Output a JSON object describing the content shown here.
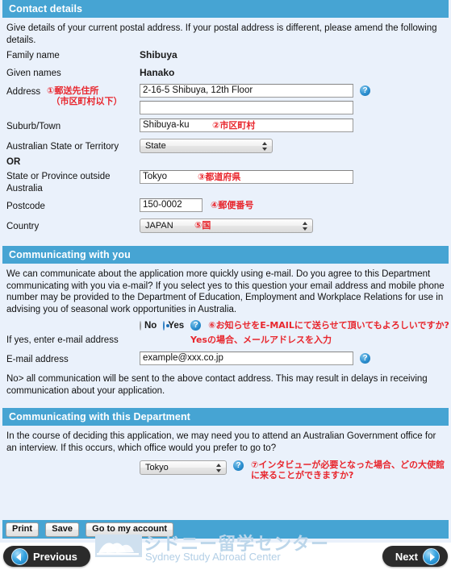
{
  "sections": {
    "contact": {
      "title": "Contact details",
      "intro": "Give details of your current postal address. If your postal address is different, please amend the following details.",
      "labels": {
        "family_name": "Family name",
        "given_names": "Given names",
        "address": "Address",
        "suburb": "Suburb/Town",
        "au_state": "Australian State or Territory",
        "or": "OR",
        "state_outside": "State or Province outside Australia",
        "postcode": "Postcode",
        "country": "Country"
      },
      "values": {
        "family_name": "Shibuya",
        "given_names": "Hanako",
        "address_line1": "2-16-5 Shibuya, 12th Floor",
        "address_line2": "",
        "suburb": "Shibuya-ku",
        "au_state": "State",
        "state_outside": "Tokyo",
        "postcode": "150-0002",
        "country": "JAPAN"
      },
      "annotations": {
        "address": "①郵送先住所\n　（市区町村以下）",
        "suburb": "②市区町村",
        "state_outside": "③都道府県",
        "postcode": "④郵便番号",
        "country": "⑤国"
      }
    },
    "communicating_you": {
      "title": "Communicating with you",
      "intro": "We can communicate about the application more quickly using e-mail. Do you agree to this Department communicating with you via e-mail? If you select yes to this question your email address and mobile phone number may be provided to the Department of Education, Employment and Workplace Relations for use in advising you of seasonal work opportunities in Australia.",
      "radio_no": "No",
      "radio_yes": "Yes",
      "selected": "Yes",
      "if_yes_label": "If yes, enter e-mail address",
      "email_label": "E-mail address",
      "email_value": "example@xxx.co.jp",
      "footnote": "No> all communication will be sent to the above contact address. This may result in delays in receiving communication about your application.",
      "annotations": {
        "radio": "⑥お知らせをE-MAILにて送らせて頂いてもよろしいですか?",
        "if_yes": "Yesの場合、メールアドレスを入力"
      }
    },
    "communicating_dept": {
      "title": "Communicating with this Department",
      "intro": "In the course of deciding this application, we may need you to attend an Australian Government office for an interview. If this occurs, which office would you prefer to go to?",
      "office_value": "Tokyo",
      "annotation": "⑦インタビューが必要となった場合、どの大使館\nに来ることができますか?"
    }
  },
  "toolbar": {
    "print": "Print",
    "save": "Save",
    "account": "Go to my account"
  },
  "nav": {
    "previous": "Previous",
    "next": "Next"
  },
  "watermark": {
    "jp": "シドニー留学センター",
    "en": "Sydney Study Abroad Center"
  },
  "icons": {
    "help": "?"
  },
  "colors": {
    "header_bar": "#46a4d3",
    "page_bg": "#eaf1fb",
    "annotation_red": "#e8262d",
    "nav_button": "#2b2b2b"
  }
}
